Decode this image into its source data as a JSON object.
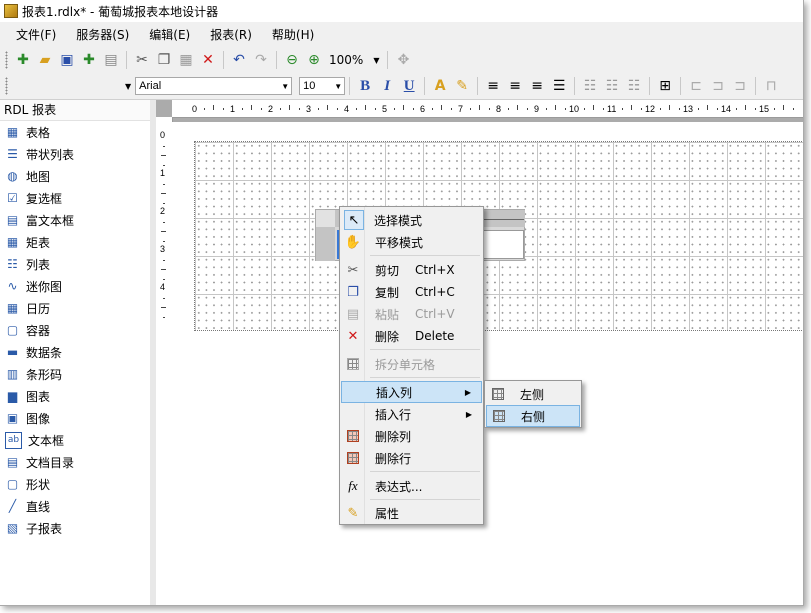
{
  "window": {
    "title": "报表1.rdlx* - 葡萄城报表本地设计器"
  },
  "menu": [
    "文件(F)",
    "服务器(S)",
    "编辑(E)",
    "报表(R)",
    "帮助(H)"
  ],
  "toolbar": {
    "zoom": "100%",
    "font_name": "Arial",
    "font_size": "10",
    "bold": "B",
    "italic": "I",
    "underline": "U"
  },
  "sidebar": {
    "header": "RDL 报表",
    "items": [
      {
        "label": "表格",
        "icon": "table-icon"
      },
      {
        "label": "带状列表",
        "icon": "banded-list-icon"
      },
      {
        "label": "地图",
        "icon": "globe-icon"
      },
      {
        "label": "复选框",
        "icon": "checkbox-icon"
      },
      {
        "label": "富文本框",
        "icon": "richtext-icon"
      },
      {
        "label": "矩表",
        "icon": "matrix-icon"
      },
      {
        "label": "列表",
        "icon": "list-icon"
      },
      {
        "label": "迷你图",
        "icon": "sparkline-icon"
      },
      {
        "label": "日历",
        "icon": "calendar-icon"
      },
      {
        "label": "容器",
        "icon": "container-icon"
      },
      {
        "label": "数据条",
        "icon": "databar-icon"
      },
      {
        "label": "条形码",
        "icon": "barcode-icon"
      },
      {
        "label": "图表",
        "icon": "chart-icon"
      },
      {
        "label": "图像",
        "icon": "image-icon"
      },
      {
        "label": "文本框",
        "icon": "textbox-icon"
      },
      {
        "label": "文档目录",
        "icon": "toc-icon"
      },
      {
        "label": "形状",
        "icon": "shape-icon"
      },
      {
        "label": "直线",
        "icon": "line-icon"
      },
      {
        "label": "子报表",
        "icon": "subreport-icon"
      }
    ]
  },
  "ruler": {
    "h_labels": [
      "0",
      "1",
      "2",
      "3",
      "4",
      "5",
      "6",
      "7",
      "8",
      "9",
      "10",
      "11",
      "12",
      "13",
      "14",
      "15"
    ],
    "v_labels": [
      "0",
      "1",
      "2",
      "3",
      "4"
    ]
  },
  "context_menu": {
    "select_mode": "选择模式",
    "pan_mode": "平移模式",
    "cut": "剪切",
    "cut_shortcut": "Ctrl+X",
    "copy": "复制",
    "copy_shortcut": "Ctrl+C",
    "paste": "粘贴",
    "paste_shortcut": "Ctrl+V",
    "delete": "删除",
    "delete_shortcut": "Delete",
    "split_cells": "拆分单元格",
    "insert_column": "插入列",
    "insert_row": "插入行",
    "delete_column": "删除列",
    "delete_row": "删除行",
    "expression": "表达式...",
    "properties": "属性"
  },
  "submenu": {
    "left": "左侧",
    "right": "右侧"
  }
}
